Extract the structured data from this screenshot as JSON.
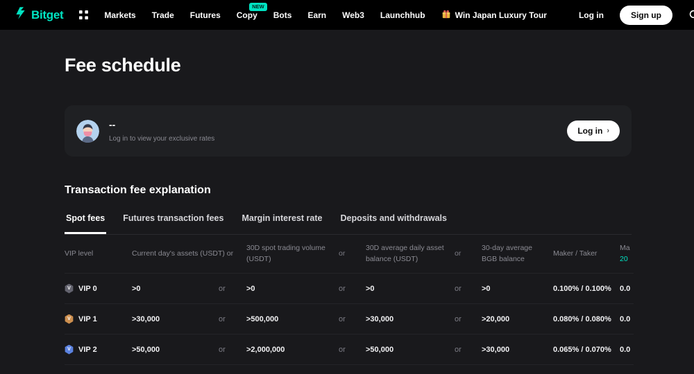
{
  "brand": {
    "name": "Bitget",
    "accent": "#00e3c2"
  },
  "nav": {
    "items": [
      {
        "label": "Markets"
      },
      {
        "label": "Trade"
      },
      {
        "label": "Futures"
      },
      {
        "label": "Copy",
        "badge": "NEW"
      },
      {
        "label": "Bots"
      },
      {
        "label": "Earn"
      },
      {
        "label": "Web3"
      },
      {
        "label": "Launchhub"
      }
    ],
    "promo_label": "Win Japan Luxury Tour",
    "login_label": "Log in",
    "signup_label": "Sign up"
  },
  "page": {
    "title": "Fee schedule"
  },
  "user_card": {
    "username": "--",
    "note": "Log in to view your exclusive rates",
    "login_label": "Log in",
    "login_chevron": "›"
  },
  "fees": {
    "section_title": "Transaction fee explanation",
    "tabs": [
      {
        "label": "Spot fees",
        "active": true
      },
      {
        "label": "Futures transaction fees",
        "active": false
      },
      {
        "label": "Margin interest rate",
        "active": false
      },
      {
        "label": "Deposits and withdrawals",
        "active": false
      }
    ],
    "table": {
      "or_label": "or",
      "headers": {
        "vip": "VIP level",
        "assets": "Current day's assets (USDT) or",
        "volume": "30D spot trading volume (USDT)",
        "balance": "30D average daily asset balance (USDT)",
        "bgb": "30-day average BGB balance",
        "maker_taker": "Maker / Taker",
        "clipped_line1": "Ma",
        "clipped_line2": "20"
      },
      "rows": [
        {
          "level": "VIP 0",
          "badge_color": "#63636e",
          "assets": ">0",
          "volume": ">0",
          "balance": ">0",
          "bgb": ">0",
          "maker_taker": "0.100% / 0.100%",
          "clipped": "0.0"
        },
        {
          "level": "VIP 1",
          "badge_color": "#cd8f4f",
          "assets": ">30,000",
          "volume": ">500,000",
          "balance": ">30,000",
          "bgb": ">20,000",
          "maker_taker": "0.080% / 0.080%",
          "clipped": "0.0"
        },
        {
          "level": "VIP 2",
          "badge_color": "#5b82e0",
          "assets": ">50,000",
          "volume": ">2,000,000",
          "balance": ">50,000",
          "bgb": ">30,000",
          "maker_taker": "0.065% / 0.070%",
          "clipped": "0.0"
        }
      ]
    }
  }
}
